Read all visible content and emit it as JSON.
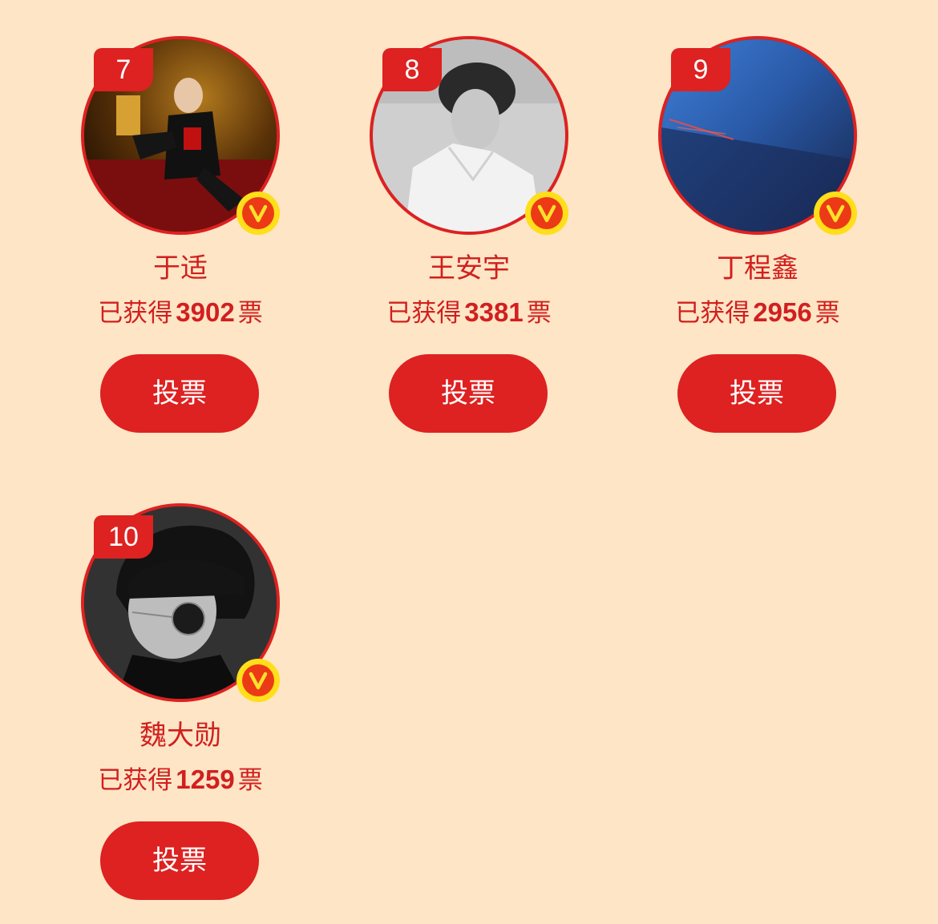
{
  "colors": {
    "background": "#fde5c5",
    "accent_red": "#de2121",
    "text_red": "#d11f1f",
    "badge_yellow": "#ffde1a",
    "badge_orange": "#ec3a16"
  },
  "candidates": [
    {
      "rank": "7",
      "name": "于适",
      "votes_prefix": "已获得",
      "votes": "3902",
      "votes_suffix": "票",
      "button_label": "投票",
      "badge_icon": "v-verified-icon"
    },
    {
      "rank": "8",
      "name": "王安宇",
      "votes_prefix": "已获得",
      "votes": "3381",
      "votes_suffix": "票",
      "button_label": "投票",
      "badge_icon": "v-verified-icon"
    },
    {
      "rank": "9",
      "name": "丁程鑫",
      "votes_prefix": "已获得",
      "votes": "2956",
      "votes_suffix": "票",
      "button_label": "投票",
      "badge_icon": "v-verified-icon"
    },
    {
      "rank": "10",
      "name": "魏大勋",
      "votes_prefix": "已获得",
      "votes": "1259",
      "votes_suffix": "票",
      "button_label": "投票",
      "badge_icon": "v-verified-icon"
    }
  ]
}
